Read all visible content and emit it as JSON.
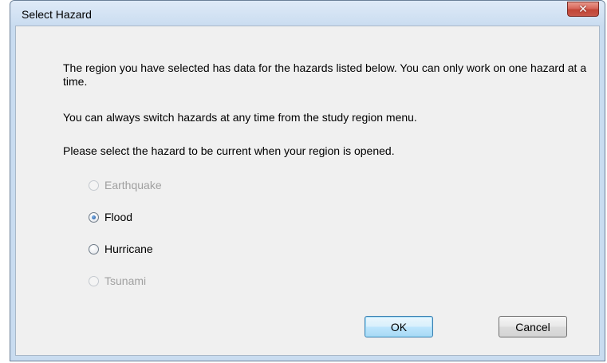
{
  "window": {
    "title": "Select Hazard",
    "close_label": "✕"
  },
  "content": {
    "intro": "The region you have selected has data for the hazards listed below.  You can only work on one hazard at a time.",
    "switch_note": "You can always switch hazards at any time from the study region menu.",
    "prompt": "Please select the hazard to be current when your region is opened."
  },
  "hazards": [
    {
      "label": "Earthquake",
      "enabled": false,
      "selected": false
    },
    {
      "label": "Flood",
      "enabled": true,
      "selected": true
    },
    {
      "label": "Hurricane",
      "enabled": true,
      "selected": false
    },
    {
      "label": "Tsunami",
      "enabled": false,
      "selected": false
    }
  ],
  "buttons": {
    "ok": "OK",
    "cancel": "Cancel"
  },
  "colors": {
    "frame": "#c9dcf0",
    "client": "#f0f0f0",
    "close_button": "#c7574a",
    "disabled_text": "#a0a0a0"
  }
}
